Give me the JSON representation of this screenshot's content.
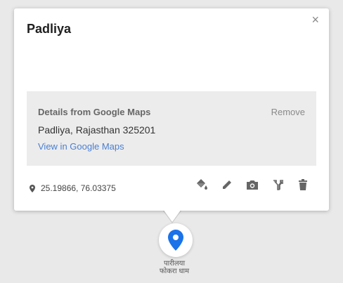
{
  "popup": {
    "title": "Padliya",
    "close_label": "×",
    "details": {
      "heading": "Details from Google Maps",
      "remove_label": "Remove",
      "address": "Padliya, Rajasthan 325201",
      "link_label": "View in Google Maps"
    },
    "coordinates": "25.19866, 76.03375",
    "tools": [
      "paint-bucket-icon",
      "pencil-icon",
      "camera-icon",
      "directions-icon",
      "trash-icon"
    ]
  },
  "map": {
    "place_label_line1": "पारीलया",
    "place_label_line2": "फोकरा धाम",
    "marker_color": "#1a73e8"
  }
}
